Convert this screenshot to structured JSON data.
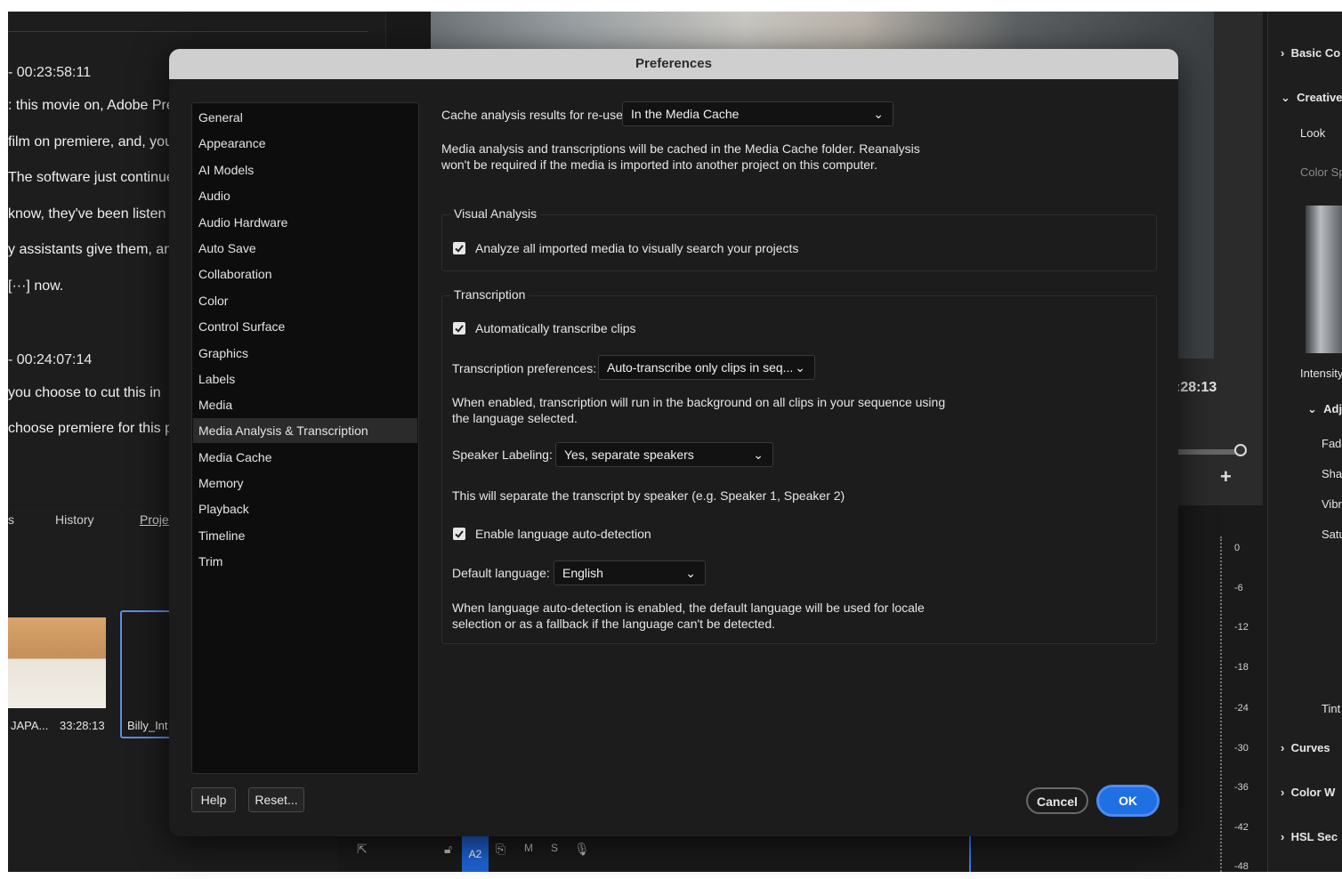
{
  "background": {
    "transcript": [
      {
        "text": "- 00:23:58:11"
      },
      {
        "text": ": this movie on, Adobe Pre"
      },
      {
        "text": "film on premiere, and, you"
      },
      {
        "text": "The software just continue"
      },
      {
        "text": "know, they've been listen"
      },
      {
        "text": "y assistants give them, an"
      },
      {
        "text": "[···] now."
      },
      {
        "text": "- 00:24:07:14"
      },
      {
        "text": "you choose to cut this in"
      },
      {
        "text": "choose premiere for this p"
      }
    ],
    "project_tabs": [
      "s",
      "History",
      "Projec"
    ],
    "thumb_labels": [
      "JAPA...",
      "33:28:13",
      "Billy_Int"
    ],
    "monitor_timecode": ":28:13",
    "plus": "+",
    "meter_ticks": [
      "0",
      "-6",
      "-12",
      "-18",
      "-24",
      "-30",
      "-36",
      "-42",
      "-48"
    ],
    "right_panel": {
      "basic": "Basic Co",
      "creative": "Creative",
      "look": "Look",
      "color_space": "Color Sp",
      "intensity": "Intensity",
      "adjust": "Adju",
      "fade": "Fade",
      "sharpen": "Shar",
      "vibrance": "Vibr",
      "saturation": "Satu",
      "tint": "Tint",
      "curves": "Curves",
      "color_wheels": "Color W",
      "hsl": "HSL Sec"
    },
    "timeline": {
      "track_label": "A2",
      "m": "M",
      "s": "S"
    }
  },
  "dialog": {
    "title": "Preferences",
    "nav": [
      "General",
      "Appearance",
      "AI Models",
      "Audio",
      "Audio Hardware",
      "Auto Save",
      "Collaboration",
      "Color",
      "Control Surface",
      "Graphics",
      "Labels",
      "Media",
      "Media Analysis & Transcription",
      "Media Cache",
      "Memory",
      "Playback",
      "Timeline",
      "Trim"
    ],
    "selected_nav": "Media Analysis & Transcription",
    "cache": {
      "label": "Cache analysis results for re-use:",
      "value": "In the Media Cache",
      "desc": "Media analysis and transcriptions will be cached in the Media Cache folder. Reanalysis won't be required if the media is imported into another project on this computer."
    },
    "visual_analysis": {
      "title": "Visual Analysis",
      "checkbox_label": "Analyze all imported media to visually search your projects",
      "checked": true
    },
    "transcription": {
      "title": "Transcription",
      "auto_label": "Automatically transcribe clips",
      "auto_checked": true,
      "pref_label": "Transcription preferences:",
      "pref_value": "Auto-transcribe only clips in seq...",
      "pref_desc": "When enabled, transcription will run in the background on all clips in your sequence using the language selected.",
      "speaker_label": "Speaker Labeling:",
      "speaker_value": "Yes, separate speakers",
      "speaker_desc": "This will separate the transcript by speaker (e.g. Speaker 1, Speaker 2)",
      "lang_detect_label": "Enable language auto-detection",
      "lang_detect_checked": true,
      "default_lang_label": "Default language:",
      "default_lang_value": "English",
      "lang_desc": "When language auto-detection is enabled, the default language will be used for locale selection or as a fallback if the language can't be detected."
    },
    "buttons": {
      "help": "Help",
      "reset": "Reset...",
      "cancel": "Cancel",
      "ok": "OK"
    },
    "colors": {
      "accent": "#1f6fe5",
      "dialog_bg": "#1c1c1c",
      "titlebar": "#cfcfcf"
    }
  }
}
